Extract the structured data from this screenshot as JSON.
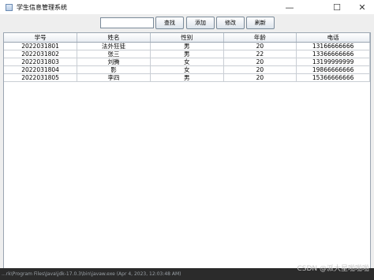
{
  "window": {
    "title": "学生信息管理系统",
    "minimize": "—",
    "maximize": "☐",
    "close": "✕"
  },
  "toolbar": {
    "search_value": "",
    "search_label": "查找",
    "add_label": "添加",
    "edit_label": "修改",
    "refresh_label": "刷新"
  },
  "table": {
    "headers": [
      "学号",
      "姓名",
      "性别",
      "年龄",
      "电话"
    ],
    "rows": [
      [
        "2022031801",
        "法外狂徒",
        "男",
        "20",
        "13166666666"
      ],
      [
        "2022031802",
        "张三",
        "男",
        "22",
        "13366666666"
      ],
      [
        "2022031803",
        "刘腾",
        "女",
        "20",
        "13199999999"
      ],
      [
        "2022031804",
        "影",
        "女",
        "20",
        "19866666666"
      ],
      [
        "2022031805",
        "李四",
        "男",
        "20",
        "15366666666"
      ]
    ]
  },
  "statusbar": {
    "text": "...rk\\Program Files\\Java\\jdk-17.0.3\\bin\\javaw.exe (Apr 4, 2023, 12:03:48 AM)"
  },
  "watermark": "CSDN @派大星啪啪啪"
}
